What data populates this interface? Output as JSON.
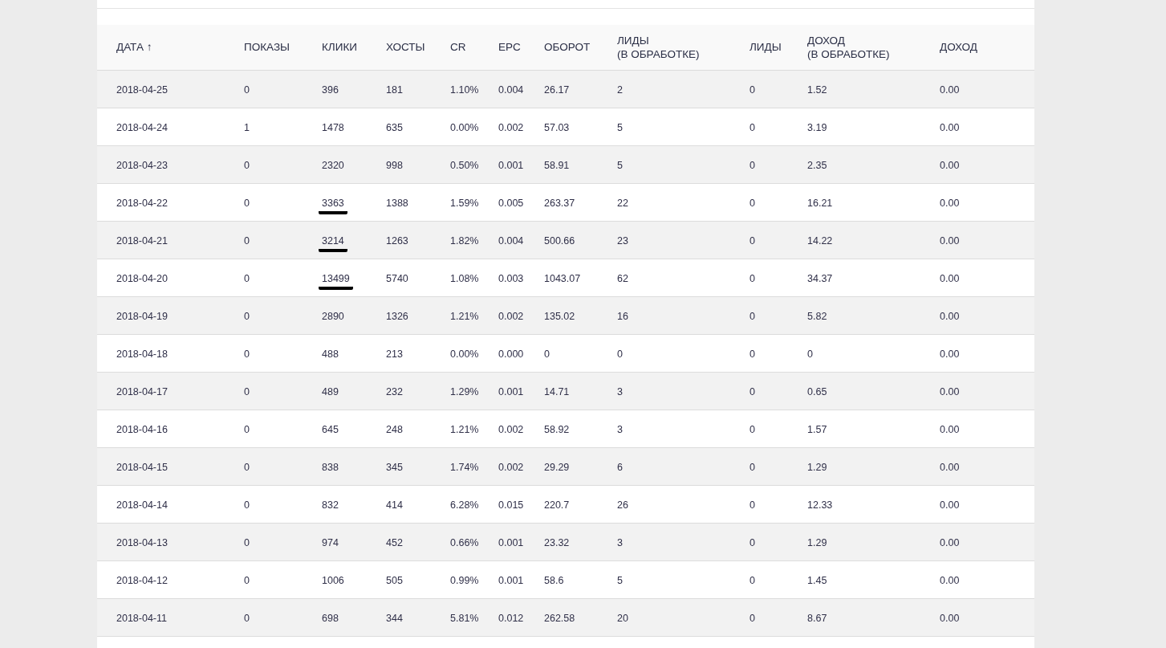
{
  "table": {
    "columns": [
      "ДАТА ↑",
      "ПОКАЗЫ",
      "КЛИКИ",
      "ХОСТЫ",
      "CR",
      "EPC",
      "ОБОРОТ",
      "ЛИДЫ\n(В ОБРАБОТКЕ)",
      "ЛИДЫ",
      "ДОХОД\n(В ОБРАБОТКЕ)",
      "ДОХОД"
    ],
    "rows": [
      {
        "cells": [
          "2018-04-25",
          "0",
          "396",
          "181",
          "1.10%",
          "0.004",
          "26.17",
          "2",
          "0",
          "1.52",
          "0.00"
        ],
        "marked": false
      },
      {
        "cells": [
          "2018-04-24",
          "1",
          "1478",
          "635",
          "0.00%",
          "0.002",
          "57.03",
          "5",
          "0",
          "3.19",
          "0.00"
        ],
        "marked": false
      },
      {
        "cells": [
          "2018-04-23",
          "0",
          "2320",
          "998",
          "0.50%",
          "0.001",
          "58.91",
          "5",
          "0",
          "2.35",
          "0.00"
        ],
        "marked": false
      },
      {
        "cells": [
          "2018-04-22",
          "0",
          "3363",
          "1388",
          "1.59%",
          "0.005",
          "263.37",
          "22",
          "0",
          "16.21",
          "0.00"
        ],
        "marked": true
      },
      {
        "cells": [
          "2018-04-21",
          "0",
          "3214",
          "1263",
          "1.82%",
          "0.004",
          "500.66",
          "23",
          "0",
          "14.22",
          "0.00"
        ],
        "marked": true
      },
      {
        "cells": [
          "2018-04-20",
          "0",
          "13499",
          "5740",
          "1.08%",
          "0.003",
          "1043.07",
          "62",
          "0",
          "34.37",
          "0.00"
        ],
        "marked": true
      },
      {
        "cells": [
          "2018-04-19",
          "0",
          "2890",
          "1326",
          "1.21%",
          "0.002",
          "135.02",
          "16",
          "0",
          "5.82",
          "0.00"
        ],
        "marked": false
      },
      {
        "cells": [
          "2018-04-18",
          "0",
          "488",
          "213",
          "0.00%",
          "0.000",
          "0",
          "0",
          "0",
          "0",
          "0.00"
        ],
        "marked": false
      },
      {
        "cells": [
          "2018-04-17",
          "0",
          "489",
          "232",
          "1.29%",
          "0.001",
          "14.71",
          "3",
          "0",
          "0.65",
          "0.00"
        ],
        "marked": false
      },
      {
        "cells": [
          "2018-04-16",
          "0",
          "645",
          "248",
          "1.21%",
          "0.002",
          "58.92",
          "3",
          "0",
          "1.57",
          "0.00"
        ],
        "marked": false
      },
      {
        "cells": [
          "2018-04-15",
          "0",
          "838",
          "345",
          "1.74%",
          "0.002",
          "29.29",
          "6",
          "0",
          "1.29",
          "0.00"
        ],
        "marked": false
      },
      {
        "cells": [
          "2018-04-14",
          "0",
          "832",
          "414",
          "6.28%",
          "0.015",
          "220.7",
          "26",
          "0",
          "12.33",
          "0.00"
        ],
        "marked": false
      },
      {
        "cells": [
          "2018-04-13",
          "0",
          "974",
          "452",
          "0.66%",
          "0.001",
          "23.32",
          "3",
          "0",
          "1.29",
          "0.00"
        ],
        "marked": false
      },
      {
        "cells": [
          "2018-04-12",
          "0",
          "1006",
          "505",
          "0.99%",
          "0.001",
          "58.6",
          "5",
          "0",
          "1.45",
          "0.00"
        ],
        "marked": false
      },
      {
        "cells": [
          "2018-04-11",
          "0",
          "698",
          "344",
          "5.81%",
          "0.012",
          "262.58",
          "20",
          "0",
          "8.67",
          "0.00"
        ],
        "marked": false
      }
    ]
  }
}
